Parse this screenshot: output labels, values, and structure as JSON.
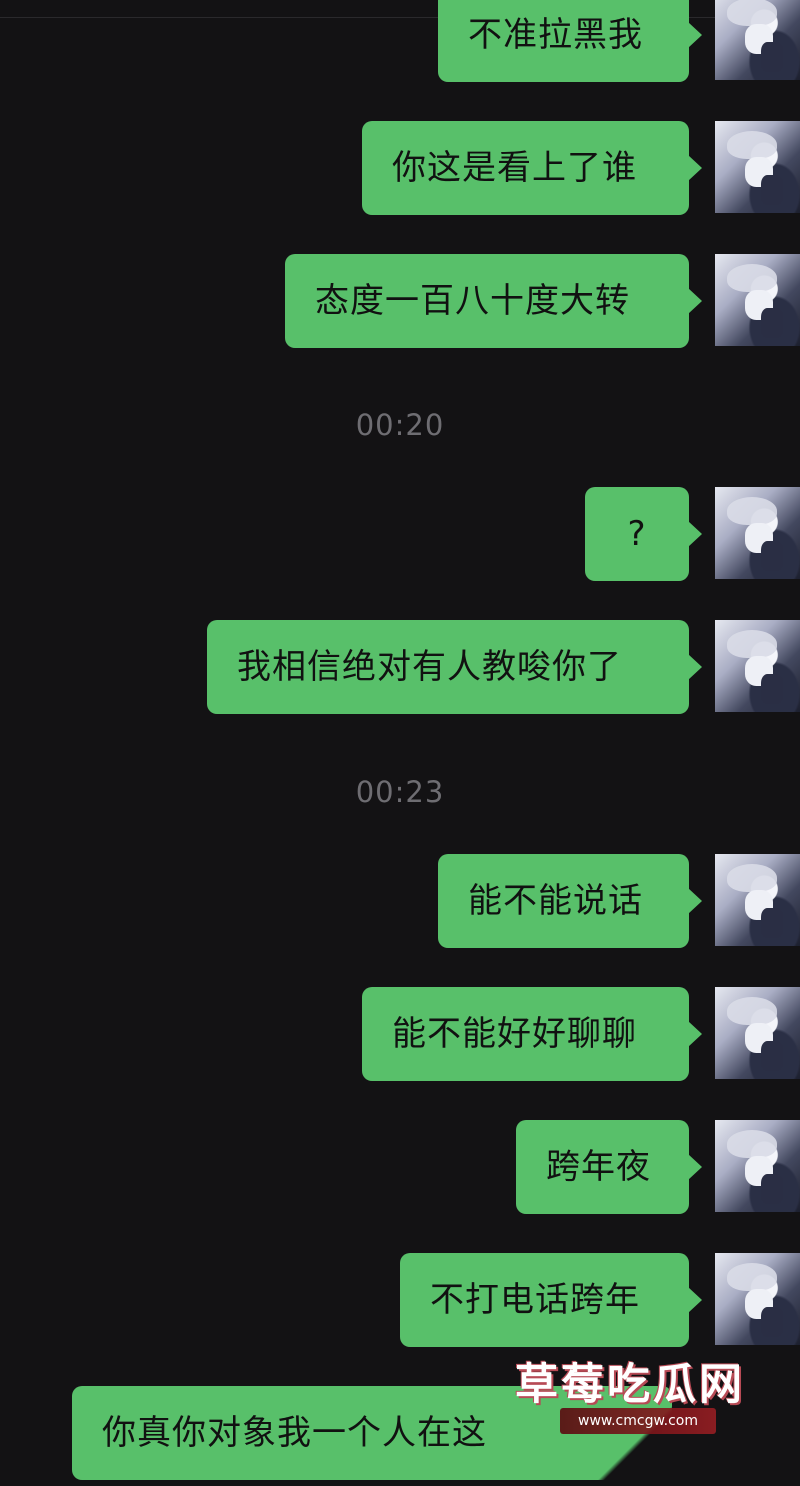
{
  "colors": {
    "background": "#131214",
    "bubble": "#58c06a",
    "timestamp": "#6e6d72"
  },
  "messages": [
    {
      "text": "不准拉黑我"
    },
    {
      "text": "你这是看上了谁"
    },
    {
      "text": "态度一百八十度大转"
    },
    {
      "text": "?"
    },
    {
      "text": "我相信绝对有人教唆你了"
    },
    {
      "text": "能不能说话"
    },
    {
      "text": "能不能好好聊聊"
    },
    {
      "text": "跨年夜"
    },
    {
      "text": "不打电话跨年"
    },
    {
      "text": "你真你对象我一个人在这"
    }
  ],
  "timestamps": [
    "00:20",
    "00:23"
  ],
  "avatar_icon": "user-avatar",
  "watermark": {
    "logo": "草莓吃瓜网",
    "url": "www.cmcgw.com"
  }
}
